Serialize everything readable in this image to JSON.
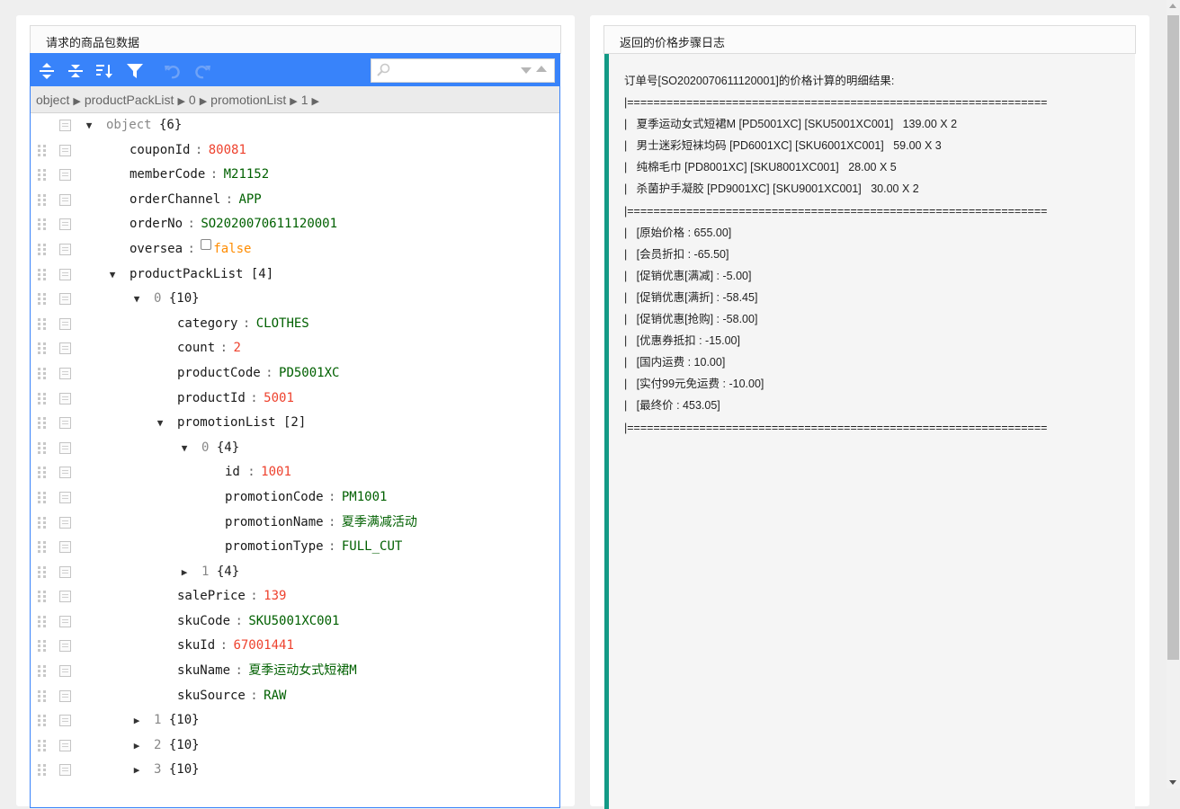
{
  "left_panel": {
    "title": "请求的商品包数据",
    "search": {
      "placeholder": ""
    },
    "breadcrumb": [
      "object",
      "productPackList",
      "0",
      "promotionList",
      "1"
    ],
    "icons": [
      "expand-all-icon",
      "collapse-all-icon",
      "sort-icon",
      "filter-icon",
      "undo-icon",
      "redo-icon",
      "search-icon",
      "search-next-icon",
      "search-previous-icon"
    ]
  },
  "tree": [
    {
      "level": 0,
      "expander": "open",
      "key": "object",
      "key_meta": true,
      "meta": "{6}"
    },
    {
      "level": 1,
      "key": "couponId",
      "value": "80081",
      "vtype": "num"
    },
    {
      "level": 1,
      "key": "memberCode",
      "value": "M21152",
      "vtype": "str"
    },
    {
      "level": 1,
      "key": "orderChannel",
      "value": "APP",
      "vtype": "str"
    },
    {
      "level": 1,
      "key": "orderNo",
      "value": "SO2020070611120001",
      "vtype": "str"
    },
    {
      "level": 1,
      "key": "oversea",
      "value": "false",
      "vtype": "bool"
    },
    {
      "level": 1,
      "expander": "open",
      "key": "productPackList",
      "meta": "[4]"
    },
    {
      "level": 2,
      "expander": "open",
      "key": "0",
      "key_meta": true,
      "meta": "{10}"
    },
    {
      "level": 3,
      "key": "category",
      "value": "CLOTHES",
      "vtype": "str"
    },
    {
      "level": 3,
      "key": "count",
      "value": "2",
      "vtype": "num"
    },
    {
      "level": 3,
      "key": "productCode",
      "value": "PD5001XC",
      "vtype": "str"
    },
    {
      "level": 3,
      "key": "productId",
      "value": "5001",
      "vtype": "num"
    },
    {
      "level": 3,
      "expander": "open",
      "key": "promotionList",
      "meta": "[2]"
    },
    {
      "level": 4,
      "expander": "open",
      "key": "0",
      "key_meta": true,
      "meta": "{4}"
    },
    {
      "level": 5,
      "key": "id  ",
      "value": "1001",
      "vtype": "num"
    },
    {
      "level": 5,
      "key": "promotionCode",
      "value": "PM1001",
      "vtype": "str"
    },
    {
      "level": 5,
      "key": "promotionName",
      "value": "夏季满减活动",
      "vtype": "str"
    },
    {
      "level": 5,
      "key": "promotionType",
      "value": "FULL_CUT",
      "vtype": "str"
    },
    {
      "level": 4,
      "expander": "closed",
      "key": "1",
      "key_meta": true,
      "meta": "{4}"
    },
    {
      "level": 3,
      "key": "salePrice",
      "value": "139",
      "vtype": "num"
    },
    {
      "level": 3,
      "key": "skuCode",
      "value": "SKU5001XC001",
      "vtype": "str"
    },
    {
      "level": 3,
      "key": "skuId",
      "value": "67001441",
      "vtype": "num"
    },
    {
      "level": 3,
      "key": "skuName",
      "value": "夏季运动女式短裙M",
      "vtype": "str"
    },
    {
      "level": 3,
      "key": "skuSource",
      "value": "RAW",
      "vtype": "str"
    },
    {
      "level": 2,
      "expander": "closed",
      "key": "1",
      "key_meta": true,
      "meta": "{10}"
    },
    {
      "level": 2,
      "expander": "closed",
      "key": "2",
      "key_meta": true,
      "meta": "{10}"
    },
    {
      "level": 2,
      "expander": "closed",
      "key": "3",
      "key_meta": true,
      "meta": "{10}"
    }
  ],
  "right_panel": {
    "title": "返回的价格步骤日志",
    "lines": [
      "订单号[SO2020070611120001]的价格计算的明细结果:",
      "|================================================================",
      "|   夏季运动女式短裙M [PD5001XC] [SKU5001XC001]   139.00 X 2",
      "|   男士迷彩短袜均码 [PD6001XC] [SKU6001XC001]   59.00 X 3",
      "|   纯棉毛巾 [PD8001XC] [SKU8001XC001]   28.00 X 5",
      "|   杀菌护手凝胶 [PD9001XC] [SKU9001XC001]   30.00 X 2",
      "|================================================================",
      "|   [原始价格 : 655.00]",
      "|   [会员折扣 : -65.50]",
      "|   [促销优惠[满减] : -5.00]",
      "|   [促销优惠[满折] : -58.45]",
      "|   [促销优惠[抢购] : -58.00]",
      "|   [优惠券抵扣 : -15.00]",
      "|   [国内运费 : 10.00]",
      "|   [实付99元免运费 : -10.00]",
      "|   [最终价 : 453.05]",
      "|================================================================"
    ]
  },
  "colors": {
    "accent": "#3883fa",
    "log_border": "#139a86",
    "number": "#ee422e",
    "string": "#006000",
    "boolean": "#ff8c00"
  }
}
